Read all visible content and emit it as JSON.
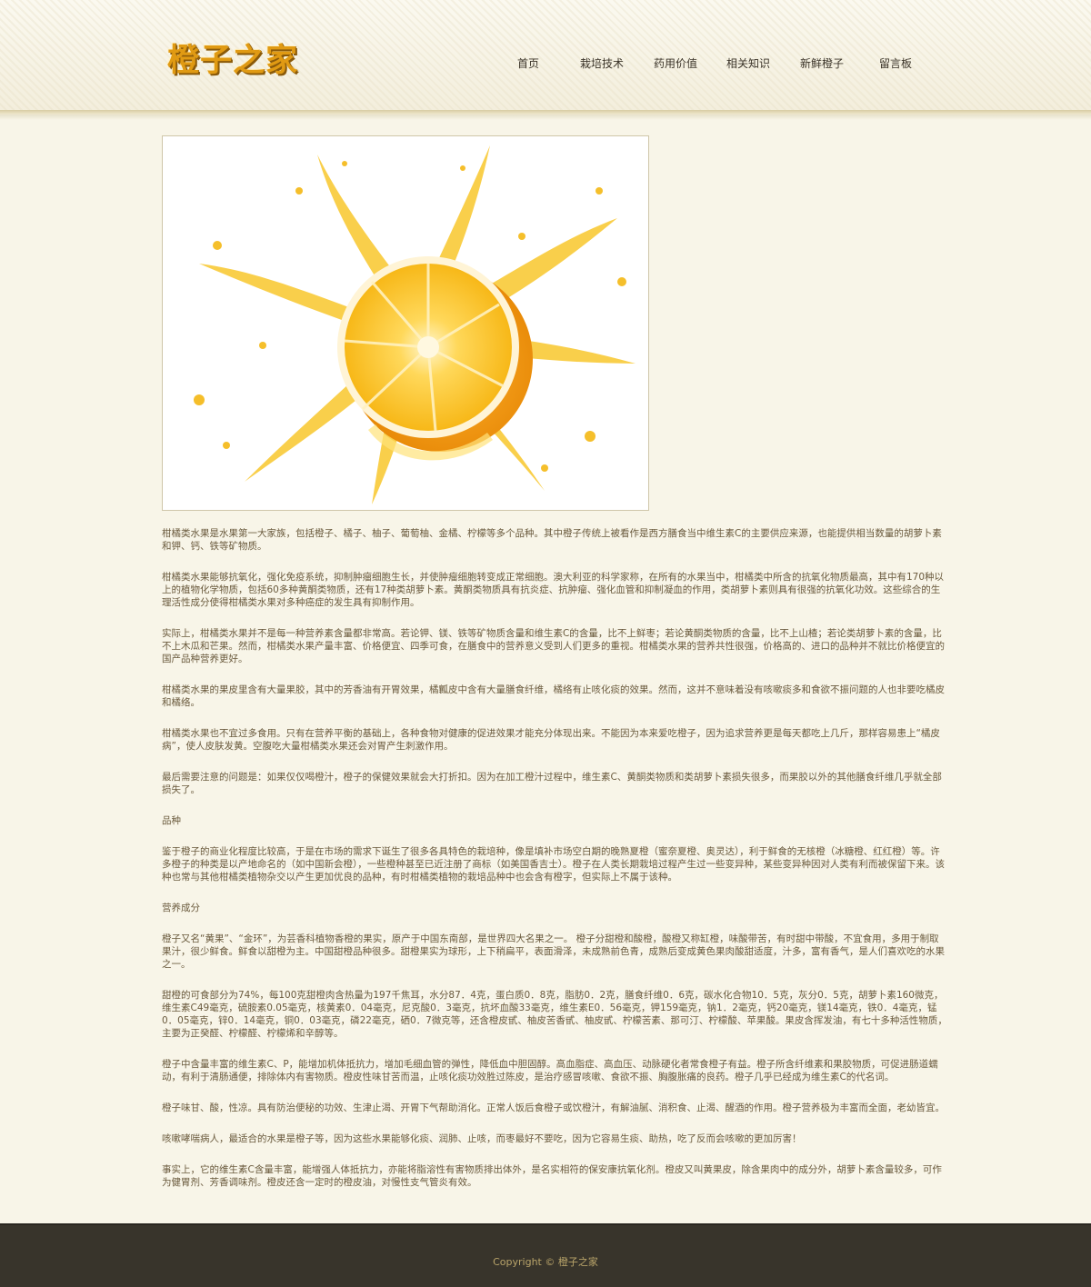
{
  "site": {
    "logo_text": "橙子之家"
  },
  "nav": {
    "items": [
      {
        "id": "home",
        "label": "首页"
      },
      {
        "id": "cultivation",
        "label": "栽培技术"
      },
      {
        "id": "medicinal",
        "label": "药用价值"
      },
      {
        "id": "knowledge",
        "label": "相关知识"
      },
      {
        "id": "fresh",
        "label": "新鲜橙子"
      },
      {
        "id": "guestbook",
        "label": "留言板"
      }
    ]
  },
  "hero": {
    "image": "orange-juice-splash"
  },
  "article": {
    "paragraphs": [
      "柑橘类水果是水果第一大家族，包括橙子、橘子、柚子、葡萄柚、金橘、柠檬等多个品种。其中橙子传统上被看作是西方膳食当中维生素C的主要供应来源，也能提供相当数量的胡萝卜素和钾、钙、铁等矿物质。",
      "柑橘类水果能够抗氧化，强化免疫系统，抑制肿瘤细胞生长，并使肿瘤细胞转变成正常细胞。澳大利亚的科学家称，在所有的水果当中，柑橘类中所含的抗氧化物质最高，其中有170种以上的植物化学物质，包括60多种黄酮类物质，还有17种类胡萝卜素。黄酮类物质具有抗炎症、抗肿瘤、强化血管和抑制凝血的作用，类胡萝卜素则具有很强的抗氧化功效。这些综合的生理活性成分使得柑橘类水果对多种癌症的发生具有抑制作用。",
      "实际上，柑橘类水果并不是每一种营养素含量都非常高。若论钾、镁、铁等矿物质含量和维生素C的含量，比不上鲜枣；若论黄酮类物质的含量，比不上山楂；若论类胡萝卜素的含量，比不上木瓜和芒果。然而，柑橘类水果产量丰富、价格便宜、四季可食，在膳食中的营养意义受到人们更多的重视。柑橘类水果的营养共性很强，价格高的、进口的品种并不就比价格便宜的国产品种营养更好。",
      "柑橘类水果的果皮里含有大量果胶，其中的芳香油有开胃效果，橘瓤皮中含有大量膳食纤维，橘络有止咳化痰的效果。然而，这并不意味着没有咳嗽痰多和食欲不振问题的人也非要吃橘皮和橘络。",
      "柑橘类水果也不宜过多食用。只有在营养平衡的基础上，各种食物对健康的促进效果才能充分体现出来。不能因为本来爱吃橙子，因为追求营养更是每天都吃上几斤，那样容易患上“橘皮病”，使人皮肤发黄。空腹吃大量柑橘类水果还会对胃产生刺激作用。",
      "最后需要注意的问题是：如果仅仅喝橙汁，橙子的保健效果就会大打折扣。因为在加工橙汁过程中，维生素C、黄酮类物质和类胡萝卜素损失很多，而果胶以外的其他膳食纤维几乎就全部损失了。",
      "品种",
      "鉴于橙子的商业化程度比较高，于是在市场的需求下诞生了很多各具特色的栽培种，像是填补市场空白期的晚熟夏橙（蜜奈夏橙、奥灵达），利于鲜食的无核橙（冰糖橙、红红橙）等。许多橙子的种类是以产地命名的（如中国新会橙），一些橙种甚至已近注册了商标（如美国香吉士）。橙子在人类长期栽培过程产生过一些变异种，某些变异种因对人类有利而被保留下来。该种也常与其他柑橘类植物杂交以产生更加优良的品种，有时柑橘类植物的栽培品种中也会含有橙字，但实际上不属于该种。",
      "营养成分",
      "橙子又名“黄果”、“金环”，为芸香科植物香橙的果实，原产于中国东南部，是世界四大名果之一。 橙子分甜橙和酸橙，酸橙又称缸橙，味酸带苦，有时甜中带酸，不宜食用，多用于制取果汁，很少鲜食。鲜食以甜橙为主。中国甜橙品种很多。甜橙果实为球形，上下稍扁平，表面滑泽，未成熟前色青，成熟后变成黄色果肉酸甜适度，汁多，富有香气，是人们喜欢吃的水果之一。",
      "甜橙的可食部分为74%，每100克甜橙肉含热量为197千焦耳，水分87．4克，蛋白质0．8克，脂肪0．2克，膳食纤维0．6克，碳水化合物10．5克，灰分0．5克，胡萝卜素160微克，维生素C49毫克，硫胺素0.05毫克，核黄素0．04毫克，尼克酸0．3毫克，抗坏血酸33毫克，维生素E0．56毫克，钾159毫克，钠1．2毫克，钙20毫克，镁14毫克，铁0．4毫克，锰0．05毫克，锌0．14毫克，铜0．03毫克，磷22毫克，硒0．7微克等，还含橙皮甙、柚皮苦香甙、柚皮甙、柠檬苦素、那可汀、柠檬酸、苹果酸。果皮含挥发油，有七十多种活性物质，主要为正癸醛、柠檬醛、柠檬烯和辛醇等。",
      "橙子中含量丰富的维生素C、P，能增加机体抵抗力，增加毛细血管的弹性，降低血中胆固醇。高血脂症、高血压、动脉硬化者常食橙子有益。橙子所含纤维素和果胶物质，可促进肠道蠕动，有利于清肠通便，排除体内有害物质。橙皮性味甘苦而温，止咳化痰功效胜过陈皮，是治疗感冒咳嗽、食欲不振、胸腹胀痛的良药。橙子几乎已经成为维生素C的代名词。",
      "橙子味甘、酸，性凉。具有防治便秘的功效、生津止渴、开胃下气帮助消化。正常人饭后食橙子或饮橙汁，有解油腻、消积食、止渴、醒酒的作用。橙子营养极为丰富而全面，老幼皆宜。",
      "咳嗽哮喘病人，最适合的水果是橙子等，因为这些水果能够化痰、润肺、止咳，而枣最好不要吃，因为它容易生痰、助热，吃了反而会咳嗽的更加厉害！",
      "事实上，它的维生素C含量丰富，能增强人体抵抗力，亦能将脂溶性有害物质排出体外，是名实相符的保安康抗氧化剂。橙皮又叫黄果皮，除含果肉中的成分外，胡萝卜素含量较多，可作为健胃剂、芳香调味剂。橙皮还含一定时的橙皮油，对慢性支气管炎有效。"
    ]
  },
  "footer": {
    "copyright": "Copyright © 橙子之家"
  }
}
